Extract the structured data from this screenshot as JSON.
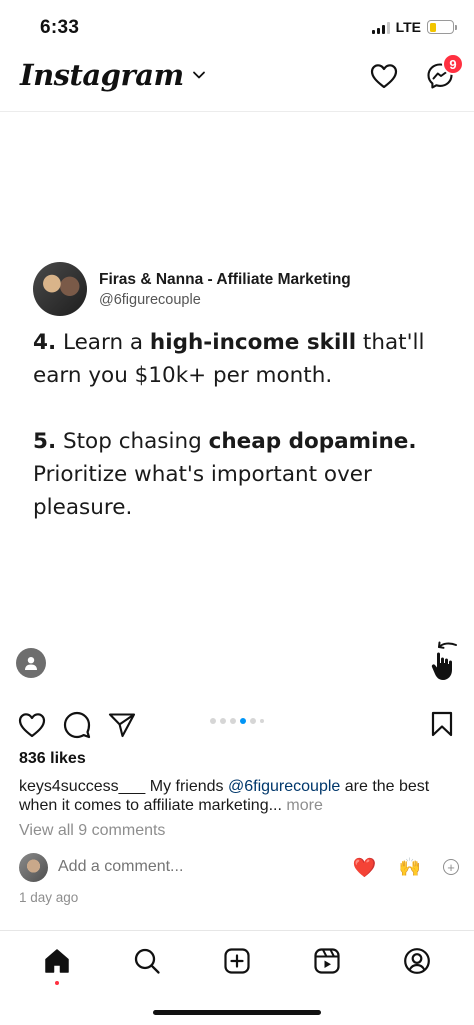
{
  "status_bar": {
    "time": "6:33",
    "network": "LTE",
    "signal_bars_active": 3,
    "battery_level": 0.28
  },
  "header": {
    "logo": "Instagram",
    "notification_badge": "9",
    "icons": [
      "chevron-down-icon",
      "heart-icon",
      "messenger-icon"
    ]
  },
  "post": {
    "author_name": "Firas & Nanna - Affiliate Marketing",
    "author_handle": "@6figurecouple",
    "slide": {
      "p1_num": "4.",
      "p1_a": " Learn a ",
      "p1_bold": "high-income skill",
      "p1_b": " that'll earn you $10k+ per month.",
      "p2_num": "5.",
      "p2_a": " Stop chasing ",
      "p2_bold": "cheap dopamine.",
      "p2_b": " Prioritize what's important over pleasure."
    },
    "carousel": {
      "count": 6,
      "active_index": 3
    },
    "likes": "836 likes",
    "caption_user": "keys4success___",
    "caption_text_a": " My friends ",
    "caption_mention": "@6figurecouple",
    "caption_text_b": " are the best when it comes to affiliate marketing",
    "caption_ellipsis": "... ",
    "caption_more": "more",
    "view_comments": "View all 9 comments",
    "add_comment_placeholder": "Add a comment...",
    "quick_reactions": [
      "❤️",
      "🙌"
    ],
    "timestamp": "1 day ago"
  },
  "colors": {
    "accent": "#0095f6",
    "badge": "#ff3040",
    "mention": "#00376b",
    "muted": "#8e8e8e",
    "battery": "#f2c500"
  },
  "tab_bar": {
    "tabs": [
      "home",
      "search",
      "create",
      "reels",
      "profile"
    ],
    "active": "home"
  }
}
